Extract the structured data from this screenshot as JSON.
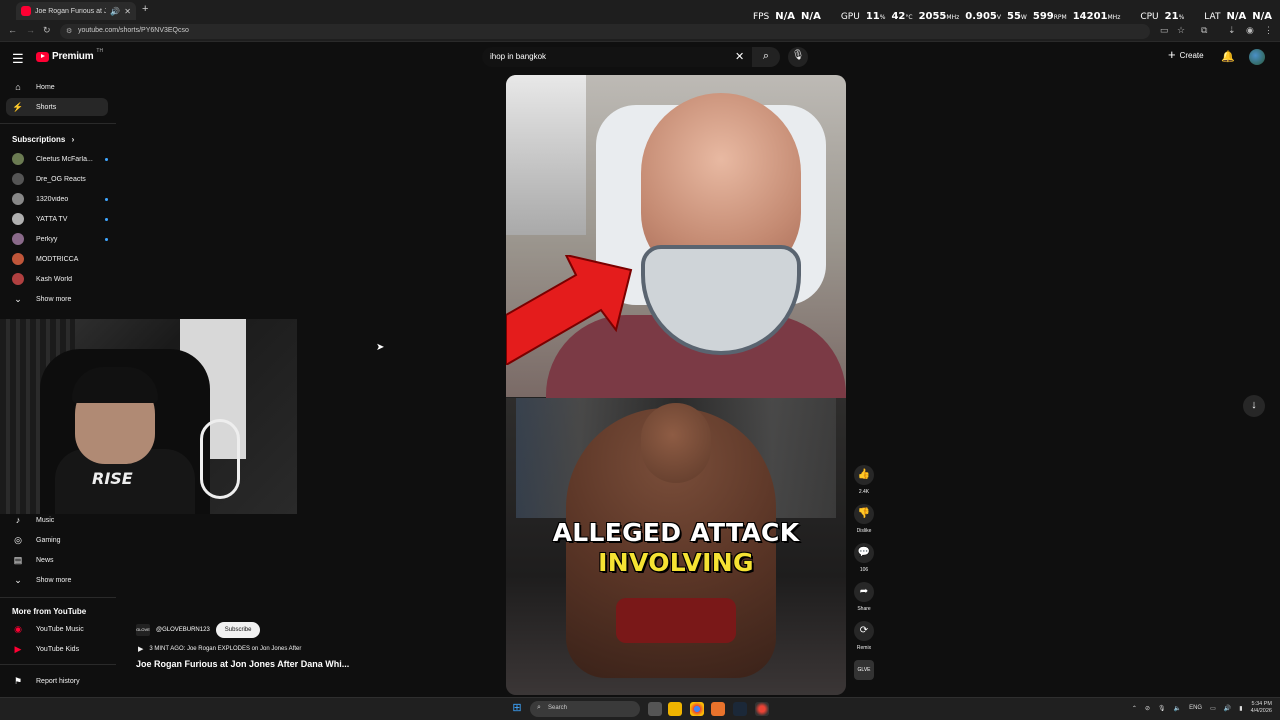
{
  "browser": {
    "tab_title": "Joe Rogan Furious at Jon J...",
    "new_tab": "+",
    "url": "youtube.com/shorts/PY6NV3EQcso"
  },
  "osd": {
    "fps_label": "FPS",
    "fps_val1": "N/A",
    "fps_val2": "N/A",
    "gpu_label": "GPU",
    "gpu_pct": "11",
    "gpu_temp": "42",
    "gpu_clock": "2055",
    "gpu_volt": "0.905",
    "gpu_watt": "55",
    "gpu_rpm": "599",
    "gpu_mem": "14201",
    "cpu_label": "CPU",
    "cpu_pct": "21",
    "lat_label": "LAT",
    "lat_val1": "N/A",
    "lat_val2": "N/A",
    "unit_pct": "%",
    "unit_temp": "°C",
    "unit_mhz": "MHz",
    "unit_v": "V",
    "unit_w": "W",
    "unit_rpm": "RPM"
  },
  "header": {
    "logo_text": "Premium",
    "logo_sup": "TH",
    "search_value": "ihop in bangkok",
    "create_label": "Create"
  },
  "sidebar": {
    "home": "Home",
    "shorts": "Shorts",
    "subscriptions": "Subscriptions",
    "subs": [
      {
        "name": "Cleetus McFarla...",
        "color": "#6b7b52",
        "dot": true
      },
      {
        "name": "Dre_OG Reacts",
        "color": "#555555",
        "dot": false
      },
      {
        "name": "1320video",
        "color": "#888888",
        "dot": true
      },
      {
        "name": "YATTA TV",
        "color": "#b0b0b0",
        "dot": true
      },
      {
        "name": "Perkyy",
        "color": "#8a6a8a",
        "dot": true
      },
      {
        "name": "MODTRICCA",
        "color": "#c0563a",
        "dot": false
      },
      {
        "name": "Kash World",
        "color": "#b04040",
        "dot": false
      }
    ],
    "show_more": "Show more",
    "music": "Music",
    "gaming": "Gaming",
    "news": "News",
    "show_more_2": "Show more",
    "more_from": "More from YouTube",
    "yt_music": "YouTube Music",
    "yt_kids": "YouTube Kids",
    "report": "Report history"
  },
  "webcam": {
    "shirt_text": "RISE"
  },
  "video": {
    "caption_line1": "ALLEGED ATTACK",
    "caption_line2": "INVOLVING",
    "channel": "@GLOVEBURN123",
    "channel_badge": "GLOVE",
    "subscribe": "Subscribe",
    "linked_video": "3 MINT AGO: Joe Rogan EXPLODES on Jon Jones After",
    "title": "Joe Rogan Furious at Jon Jones After Dana Whi..."
  },
  "rail": {
    "likes": "2.4K",
    "dislike": "Dislike",
    "comments": "106",
    "share": "Share",
    "remix": "Remix",
    "thumb_label": "GLVE"
  },
  "taskbar": {
    "search": "Search",
    "lang": "ENG",
    "time": "5:34 PM",
    "date": "4/4/2026"
  },
  "colors": {
    "yt_red": "#ff0033",
    "bg": "#0f0f0f",
    "caption_yellow": "#f5e233"
  }
}
